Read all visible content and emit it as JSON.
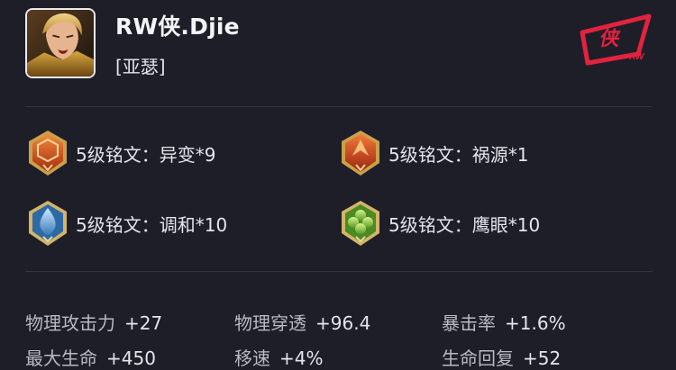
{
  "player": {
    "name": "RW侠.Djie",
    "hero": "[亚瑟]"
  },
  "runes": [
    {
      "label": "5级铭文：异变*9",
      "icon": "rune-red-hex-icon"
    },
    {
      "label": "5级铭文：祸源*1",
      "icon": "rune-red-shard-icon"
    },
    {
      "label": "5级铭文：调和*10",
      "icon": "rune-blue-drop-icon"
    },
    {
      "label": "5级铭文：鹰眼*10",
      "icon": "rune-green-clover-icon"
    }
  ],
  "stats": [
    {
      "label": "物理攻击力",
      "value": "+27"
    },
    {
      "label": "物理穿透",
      "value": "+96.4"
    },
    {
      "label": "暴击率",
      "value": "+1.6%"
    },
    {
      "label": "最大生命",
      "value": "+450"
    },
    {
      "label": "移速",
      "value": "+4%"
    },
    {
      "label": "生命回复",
      "value": "+52"
    }
  ],
  "colors": {
    "background": "#1e1e28",
    "logo": "#e2233f"
  }
}
